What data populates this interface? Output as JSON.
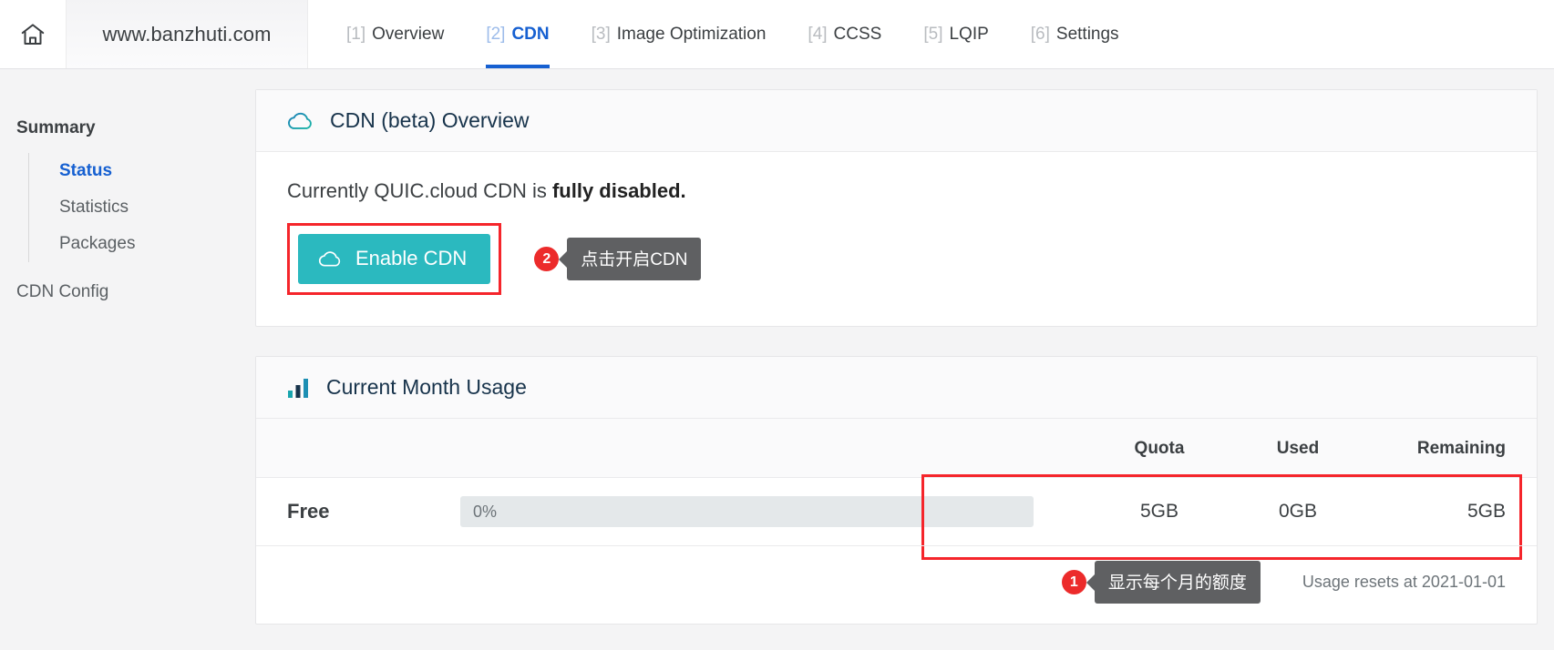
{
  "topbar": {
    "home_icon": "home-icon",
    "site_name": "www.banzhuti.com",
    "tabs": [
      {
        "num": "[1]",
        "label": "Overview",
        "active": false
      },
      {
        "num": "[2]",
        "label": "CDN",
        "active": true
      },
      {
        "num": "[3]",
        "label": "Image Optimization",
        "active": false
      },
      {
        "num": "[4]",
        "label": "CCSS",
        "active": false
      },
      {
        "num": "[5]",
        "label": "LQIP",
        "active": false
      },
      {
        "num": "[6]",
        "label": "Settings",
        "active": false
      }
    ]
  },
  "sidebar": {
    "heading": "Summary",
    "items": [
      {
        "label": "Status",
        "active": true
      },
      {
        "label": "Statistics",
        "active": false
      },
      {
        "label": "Packages",
        "active": false
      }
    ],
    "cdn_config": "CDN Config"
  },
  "overview_card": {
    "icon": "cloud-icon",
    "title": "CDN (beta) Overview",
    "status_prefix": "Currently QUIC.cloud CDN is ",
    "status_strong": "fully disabled.",
    "enable_button": {
      "icon": "cloud-icon",
      "label": "Enable CDN"
    },
    "callout": {
      "badge": "2",
      "text": "点击开启CDN"
    }
  },
  "usage_card": {
    "icon": "bar-chart-icon",
    "title": "Current Month Usage",
    "columns": {
      "plan": "",
      "bar": "",
      "quota": "Quota",
      "used": "Used",
      "remaining": "Remaining"
    },
    "rows": [
      {
        "plan": "Free",
        "progress_label": "0%",
        "progress_percent": 0,
        "quota": "5GB",
        "used": "0GB",
        "remaining": "5GB"
      }
    ],
    "callout": {
      "badge": "1",
      "text": "显示每个月的额度"
    },
    "reset_text": "Usage resets at 2021-01-01"
  },
  "colors": {
    "accent_blue": "#1660d1",
    "teal_button": "#2bb9bf",
    "annotation_red": "#f5252b",
    "badge_red": "#ec2b2b",
    "bubble_gray": "#5f6062",
    "title_navy": "#17334b"
  }
}
